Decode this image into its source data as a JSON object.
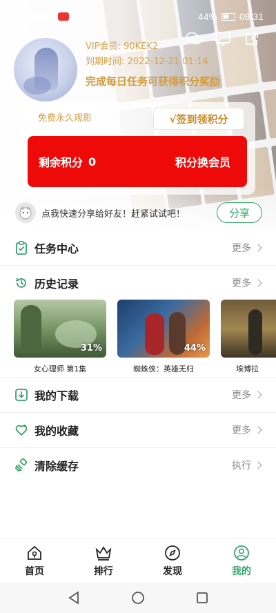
{
  "status": {
    "battery": "44%",
    "time": "08:31"
  },
  "user": {
    "vip_label": "VIP会员: 90KEK2",
    "expiry": "到期时间: 2022-12-21 01:14",
    "task_hint": "完成每日任务可获得积分奖励"
  },
  "points": {
    "free_label": "免费永久观影",
    "signin_label": "√签到领积分",
    "remaining_label": "剩余积分",
    "remaining_value": "0",
    "exchange_label": "积分换会员"
  },
  "share": {
    "text": "点我快速分享给好友！赶紧试试吧！",
    "button": "分享"
  },
  "sections": {
    "tasks": {
      "title": "任务中心",
      "action": "更多"
    },
    "history": {
      "title": "历史记录",
      "action": "更多"
    },
    "downloads": {
      "title": "我的下载",
      "action": "更多"
    },
    "favorites": {
      "title": "我的收藏",
      "action": "更多"
    },
    "cache": {
      "title": "清除缓存",
      "action": "执行"
    }
  },
  "history_items": [
    {
      "title": "女心理师 第1集",
      "progress": "31%"
    },
    {
      "title": "蜘蛛侠：英雄无归",
      "progress": "44%"
    },
    {
      "title": "埃博拉"
    }
  ],
  "tabs": [
    {
      "label": "首页"
    },
    {
      "label": "排行"
    },
    {
      "label": "发现"
    },
    {
      "label": "我的"
    }
  ],
  "theme": {
    "accent_green": "#35a36b",
    "points_red": "#ef0a0a",
    "gold": "#d39a3c"
  }
}
